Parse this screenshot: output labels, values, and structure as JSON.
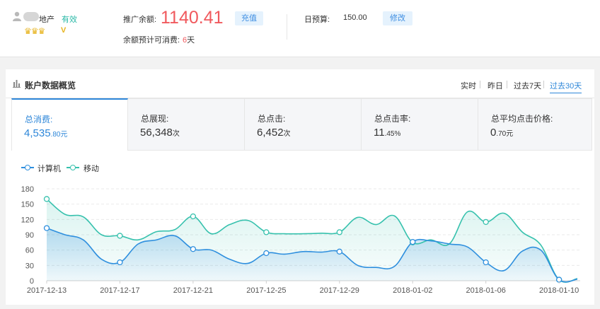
{
  "account": {
    "name_suffix": "地产",
    "status": "有效",
    "level_icons": "♛♛♛",
    "badge": "V"
  },
  "balance": {
    "label": "推广余额:",
    "value": "1140.41",
    "recharge_button": "充值",
    "days_label": "余额预计可消费:",
    "days_value": "6",
    "days_unit": "天"
  },
  "budget": {
    "label": "日预算:",
    "value": "150.00",
    "edit_button": "修改"
  },
  "panel": {
    "title": "账户数据概览",
    "ranges": [
      "实时",
      "昨日",
      "过去7天",
      "过去30天"
    ],
    "active_range": 3
  },
  "tabs": [
    {
      "label": "总消费:",
      "main": "4,535",
      "small": ".80元",
      "active": true
    },
    {
      "label": "总展现:",
      "main": "56,348",
      "small": "次",
      "active": false
    },
    {
      "label": "总点击:",
      "main": "6,452",
      "small": "次",
      "active": false
    },
    {
      "label": "总点击率:",
      "main": "11",
      "small": ".45%",
      "active": false
    },
    {
      "label": "总平均点击价格:",
      "main": "0",
      "small": ".70元",
      "active": false
    }
  ],
  "colors": {
    "accent": "#2e87d9",
    "computer": "#2e8fde",
    "mobile": "#36c1ad",
    "balance": "#f0595d"
  },
  "chart_data": {
    "type": "area",
    "x_tick_labels": [
      "2017-12-13",
      "2017-12-17",
      "2017-12-21",
      "2017-12-25",
      "2017-12-29",
      "2018-01-02",
      "2018-01-06",
      "2018-01-10"
    ],
    "x": [
      "2017-12-13",
      "2017-12-14",
      "2017-12-15",
      "2017-12-16",
      "2017-12-17",
      "2017-12-18",
      "2017-12-19",
      "2017-12-20",
      "2017-12-21",
      "2017-12-22",
      "2017-12-23",
      "2017-12-24",
      "2017-12-25",
      "2017-12-26",
      "2017-12-27",
      "2017-12-28",
      "2017-12-29",
      "2017-12-30",
      "2017-12-31",
      "2018-01-01",
      "2018-01-02",
      "2018-01-03",
      "2018-01-04",
      "2018-01-05",
      "2018-01-06",
      "2018-01-07",
      "2018-01-08",
      "2018-01-09",
      "2018-01-10",
      "2018-01-11"
    ],
    "series": [
      {
        "name": "计算机",
        "color": "#2e8fde",
        "values": [
          103,
          90,
          80,
          42,
          36,
          72,
          80,
          88,
          62,
          60,
          42,
          34,
          54,
          52,
          57,
          56,
          57,
          30,
          26,
          28,
          76,
          78,
          72,
          66,
          36,
          20,
          58,
          60,
          2,
          3
        ],
        "markers": [
          0,
          4,
          8,
          12,
          16,
          20,
          24,
          28
        ]
      },
      {
        "name": "移动",
        "color": "#36c1ad",
        "values": [
          160,
          130,
          125,
          90,
          88,
          80,
          96,
          100,
          126,
          92,
          110,
          118,
          95,
          92,
          92,
          93,
          95,
          124,
          110,
          127,
          75,
          80,
          72,
          135,
          115,
          132,
          95,
          70,
          2,
          4
        ],
        "markers": [
          0,
          4,
          8,
          12,
          16,
          20,
          24,
          28
        ]
      }
    ],
    "ylim": [
      0,
      180
    ],
    "yticks": [
      0,
      30,
      60,
      90,
      120,
      150,
      180
    ],
    "grid": true,
    "legend": "top-left"
  }
}
